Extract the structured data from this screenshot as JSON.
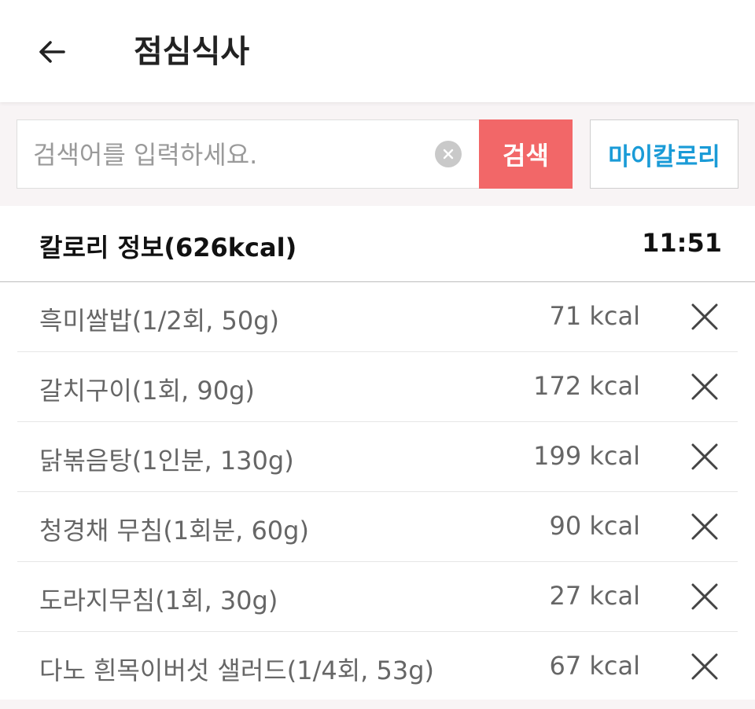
{
  "header": {
    "back_icon": "arrow-left-icon",
    "title": "점심식사"
  },
  "search": {
    "placeholder": "검색어를 입력하세요.",
    "value": "",
    "clear_icon": "clear-circle-icon",
    "button_label": "검색",
    "my_calorie_label": "마이칼로리"
  },
  "calorie_info": {
    "title": "칼로리 정보(626kcal)",
    "time": "11:51"
  },
  "foods": [
    {
      "name": "흑미쌀밥(1/2회, 50g)",
      "kcal": "71 kcal"
    },
    {
      "name": "갈치구이(1회, 90g)",
      "kcal": "172 kcal"
    },
    {
      "name": "닭볶음탕(1인분, 130g)",
      "kcal": "199 kcal"
    },
    {
      "name": "청경채 무침(1회분, 60g)",
      "kcal": "90 kcal"
    },
    {
      "name": "도라지무침(1회, 30g)",
      "kcal": "27 kcal"
    },
    {
      "name": "다노 흰목이버섯 샐러드(1/4회, 53g)",
      "kcal": "67 kcal"
    }
  ],
  "colors": {
    "search_button": "#f26768",
    "my_calorie_text": "#1a9bd7",
    "background": "#f8f4f5"
  }
}
